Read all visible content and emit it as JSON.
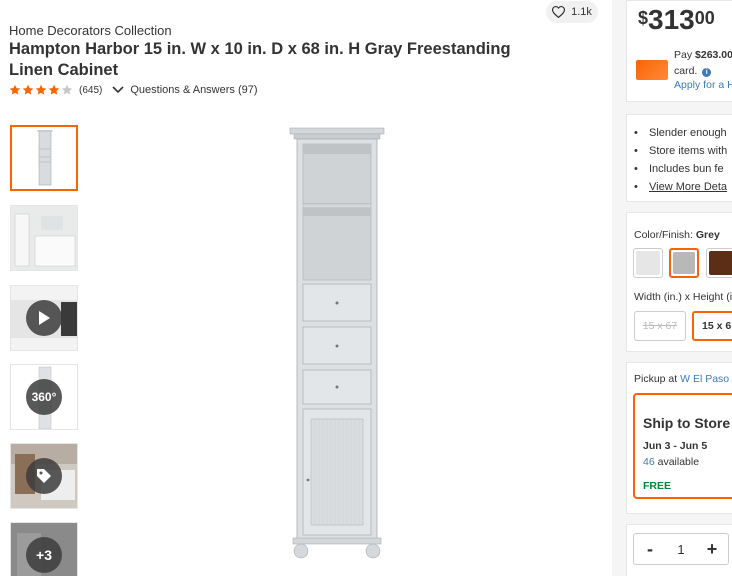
{
  "product": {
    "brand": "Home Decorators Collection",
    "title": "Hampton Harbor 15 in. W x 10 in. D x 68 in. H Gray Freestanding Linen Cabinet",
    "rating": 4.0,
    "rating_max": 5,
    "review_count": "(645)",
    "qa_label": "Questions & Answers (97)",
    "favorites": "1.1k"
  },
  "thumbnails": [
    {
      "name": "main-view",
      "overlay": ""
    },
    {
      "name": "room-view",
      "overlay": ""
    },
    {
      "name": "video",
      "overlay": "play"
    },
    {
      "name": "spin-360",
      "overlay": "360°"
    },
    {
      "name": "sale-tag",
      "overlay": ""
    },
    {
      "name": "more",
      "overlay": "+3"
    }
  ],
  "pricing": {
    "symbol": "$",
    "dollars": "313",
    "cents": "00",
    "pay_prefix": "Pay",
    "pay_amount": "$263.00",
    "pay_suffix": "card.",
    "apply_label": "Apply for a H"
  },
  "highlights": [
    "Slender enough",
    "Store items with",
    "Includes bun fe",
    "View More Deta"
  ],
  "options": {
    "finish_label": "Color/Finish:",
    "finish_value": "Grey",
    "swatches": [
      {
        "name": "white",
        "color": "#e6e6e6"
      },
      {
        "name": "grey",
        "color": "#b8b8b8"
      },
      {
        "name": "brown",
        "color": "#5c2e16"
      }
    ],
    "size_label": "Width (in.) x Height (in",
    "sizes": [
      "15 x 67",
      "15 x 6"
    ]
  },
  "fulfillment": {
    "pickup_prefix": "Pickup at",
    "store_location": "W El Paso",
    "ship_title": "Ship to Store",
    "date_range": "Jun 3 - Jun 5",
    "available_count": "46",
    "available_label": "available",
    "cost": "FREE"
  },
  "quantity": {
    "minus": "-",
    "value": "1",
    "plus": "+"
  },
  "colors": {
    "accent": "#f96302",
    "link": "#3e7bb6",
    "free": "#00873c",
    "star": "#f96302"
  }
}
